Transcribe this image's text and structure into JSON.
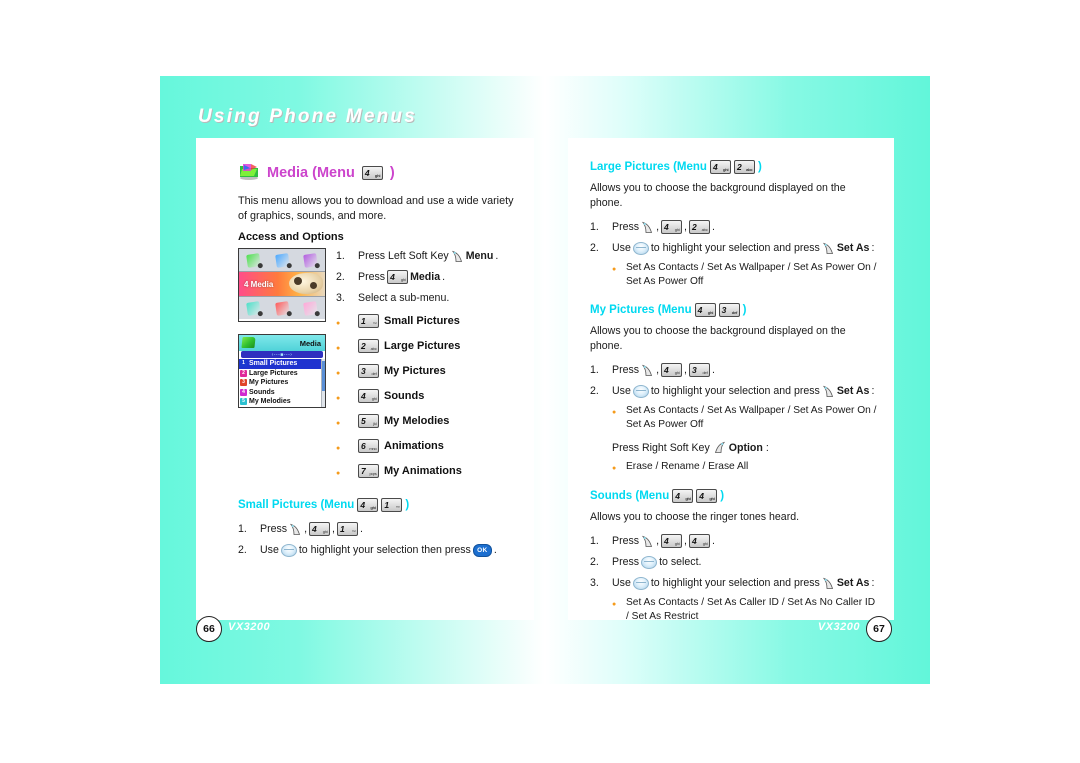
{
  "banner": {
    "title": "Using Phone Menus"
  },
  "footer": {
    "left_page": "66",
    "left_model": "VX3200",
    "right_page": "67",
    "right_model": "VX3200"
  },
  "colors": {
    "banner_teal": "#66f7dc",
    "heading_magenta": "#cc44cc",
    "section_cyan": "#00d9f0",
    "bullet_orange": "#f59b1c",
    "ok_blue": "#1c6fd0"
  },
  "left_page": {
    "heading": {
      "icon": "media-folder-icon",
      "text_before": "Media (Menu",
      "key": {
        "digit": "4",
        "sub": "ghi"
      },
      "text_after": ")"
    },
    "intro": "This menu allows you to download and use a wide variety of graphics, sounds, and more.",
    "access_heading": "Access and Options",
    "steps": [
      {
        "n": "1.",
        "parts": [
          {
            "type": "text",
            "value": "Press Left Soft Key"
          },
          {
            "type": "softkey",
            "value": "left-soft-key-icon"
          },
          {
            "type": "bold",
            "value": "Menu"
          },
          {
            "type": "text",
            "value": "."
          }
        ]
      },
      {
        "n": "2.",
        "parts": [
          {
            "type": "text",
            "value": "Press"
          },
          {
            "type": "key",
            "digit": "4",
            "sub": "ghi"
          },
          {
            "type": "bold",
            "value": "Media"
          },
          {
            "type": "text",
            "value": "."
          }
        ]
      },
      {
        "n": "3.",
        "parts": [
          {
            "type": "text",
            "value": "Select a sub-menu."
          }
        ]
      }
    ],
    "submenus": [
      {
        "digit": "1",
        "sub": "™",
        "label": "Small Pictures"
      },
      {
        "digit": "2",
        "sub": "abc",
        "label": "Large Pictures"
      },
      {
        "digit": "3",
        "sub": "def",
        "label": "My Pictures"
      },
      {
        "digit": "4",
        "sub": "ghi",
        "label": "Sounds"
      },
      {
        "digit": "5",
        "sub": "jkl",
        "label": "My Melodies"
      },
      {
        "digit": "6",
        "sub": "mno",
        "label": "Animations"
      },
      {
        "digit": "7",
        "sub": "pqrs",
        "label": "My Animations"
      }
    ],
    "small_pictures": {
      "heading_text": "Small Pictures (Menu",
      "heading_keys": [
        {
          "digit": "4",
          "sub": "ghi"
        },
        {
          "digit": "1",
          "sub": "™"
        }
      ],
      "heading_close": ")",
      "steps": [
        {
          "n": "1.",
          "parts": [
            {
              "type": "text",
              "value": "Press"
            },
            {
              "type": "softkey",
              "value": "left-soft-key-icon"
            },
            {
              "type": "text",
              "value": ","
            },
            {
              "type": "key",
              "digit": "4",
              "sub": "ghi"
            },
            {
              "type": "text",
              "value": ","
            },
            {
              "type": "key",
              "digit": "1",
              "sub": "™"
            },
            {
              "type": "text",
              "value": "."
            }
          ]
        },
        {
          "n": "2.",
          "parts": [
            {
              "type": "text",
              "value": "Use"
            },
            {
              "type": "navkey",
              "value": "navigation-key-icon"
            },
            {
              "type": "text",
              "value": "to highlight your selection then press"
            },
            {
              "type": "okkey",
              "value": "OK"
            },
            {
              "type": "text",
              "value": "."
            }
          ]
        }
      ]
    },
    "shot_menu_grid": {
      "title": "4  Media",
      "icons_top": [
        "camera-icon",
        "messaging-icon",
        "contacts-icon"
      ],
      "icons_bottom": [
        "media-icon",
        "games-icon",
        "settings-icon"
      ]
    },
    "shot_menu_list": {
      "header_title": "Media",
      "items": [
        {
          "num": "1",
          "label": "Small Pictures",
          "selected": true
        },
        {
          "num": "2",
          "label": "Large Pictures",
          "selected": false
        },
        {
          "num": "3",
          "label": "My Pictures",
          "selected": false
        },
        {
          "num": "4",
          "label": "Sounds",
          "selected": false
        },
        {
          "num": "5",
          "label": "My Melodies",
          "selected": false
        }
      ]
    }
  },
  "right_page": {
    "sections": [
      {
        "heading_text": "Large Pictures (Menu",
        "heading_keys": [
          {
            "digit": "4",
            "sub": "ghi"
          },
          {
            "digit": "2",
            "sub": "abc"
          }
        ],
        "heading_close": ")",
        "body": "Allows you to choose the background displayed on the phone.",
        "steps": [
          {
            "n": "1.",
            "parts": [
              {
                "type": "text",
                "value": "Press"
              },
              {
                "type": "softkey",
                "value": "left-soft-key-icon"
              },
              {
                "type": "text",
                "value": ","
              },
              {
                "type": "key",
                "digit": "4",
                "sub": "ghi"
              },
              {
                "type": "text",
                "value": ","
              },
              {
                "type": "key",
                "digit": "2",
                "sub": "abc"
              },
              {
                "type": "text",
                "value": "."
              }
            ]
          },
          {
            "n": "2.",
            "parts": [
              {
                "type": "text",
                "value": "Use"
              },
              {
                "type": "navkey",
                "value": "navigation-key-icon"
              },
              {
                "type": "text",
                "value": "to highlight your selection and press"
              },
              {
                "type": "softkey",
                "value": "left-soft-key-icon"
              },
              {
                "type": "bold",
                "value": "Set As"
              },
              {
                "type": "text",
                "value": ":"
              }
            ]
          }
        ],
        "bullets": [
          "Set As Contacts / Set As Wallpaper / Set As Power On / Set As Power Off"
        ],
        "extra": null
      },
      {
        "heading_text": "My Pictures (Menu",
        "heading_keys": [
          {
            "digit": "4",
            "sub": "ghi"
          },
          {
            "digit": "3",
            "sub": "def"
          }
        ],
        "heading_close": ")",
        "body": "Allows you to choose the background displayed on the phone.",
        "steps": [
          {
            "n": "1.",
            "parts": [
              {
                "type": "text",
                "value": "Press"
              },
              {
                "type": "softkey",
                "value": "left-soft-key-icon"
              },
              {
                "type": "text",
                "value": ","
              },
              {
                "type": "key",
                "digit": "4",
                "sub": "ghi"
              },
              {
                "type": "text",
                "value": ","
              },
              {
                "type": "key",
                "digit": "3",
                "sub": "def"
              },
              {
                "type": "text",
                "value": "."
              }
            ]
          },
          {
            "n": "2.",
            "parts": [
              {
                "type": "text",
                "value": "Use"
              },
              {
                "type": "navkey",
                "value": "navigation-key-icon"
              },
              {
                "type": "text",
                "value": "to highlight your selection and press"
              },
              {
                "type": "softkey",
                "value": "left-soft-key-icon"
              },
              {
                "type": "bold",
                "value": "Set As"
              },
              {
                "type": "text",
                "value": ":"
              }
            ]
          }
        ],
        "bullets": [
          "Set As Contacts / Set As Wallpaper / Set As Power On / Set As Power Off"
        ],
        "extra": {
          "line_parts": [
            {
              "type": "text",
              "value": "Press Right  Soft Key"
            },
            {
              "type": "rightsoftkey",
              "value": "right-soft-key-icon"
            },
            {
              "type": "bold",
              "value": "Option"
            },
            {
              "type": "text",
              "value": ":"
            }
          ],
          "bullets": [
            "Erase / Rename / Erase All"
          ]
        }
      },
      {
        "heading_text": "Sounds (Menu",
        "heading_keys": [
          {
            "digit": "4",
            "sub": "ghi"
          },
          {
            "digit": "4",
            "sub": "ghi"
          }
        ],
        "heading_close": ")",
        "body": "Allows you to choose the ringer tones heard.",
        "steps": [
          {
            "n": "1.",
            "parts": [
              {
                "type": "text",
                "value": "Press"
              },
              {
                "type": "softkey",
                "value": "left-soft-key-icon"
              },
              {
                "type": "text",
                "value": ","
              },
              {
                "type": "key",
                "digit": "4",
                "sub": "ghi"
              },
              {
                "type": "text",
                "value": ","
              },
              {
                "type": "key",
                "digit": "4",
                "sub": "ghi"
              },
              {
                "type": "text",
                "value": "."
              }
            ]
          },
          {
            "n": "2.",
            "parts": [
              {
                "type": "text",
                "value": "Press"
              },
              {
                "type": "navkey",
                "value": "navigation-key-icon"
              },
              {
                "type": "text",
                "value": "to select."
              }
            ]
          },
          {
            "n": "3.",
            "parts": [
              {
                "type": "text",
                "value": "Use"
              },
              {
                "type": "navkey",
                "value": "navigation-key-icon"
              },
              {
                "type": "text",
                "value": "to highlight your selection and press"
              },
              {
                "type": "softkey",
                "value": "left-soft-key-icon"
              },
              {
                "type": "bold",
                "value": "Set As"
              },
              {
                "type": "text",
                "value": ":"
              }
            ]
          }
        ],
        "bullets": [
          "Set As Contacts / Set As Caller ID / Set As No Caller ID / Set As Restrict"
        ],
        "extra": null
      }
    ]
  }
}
